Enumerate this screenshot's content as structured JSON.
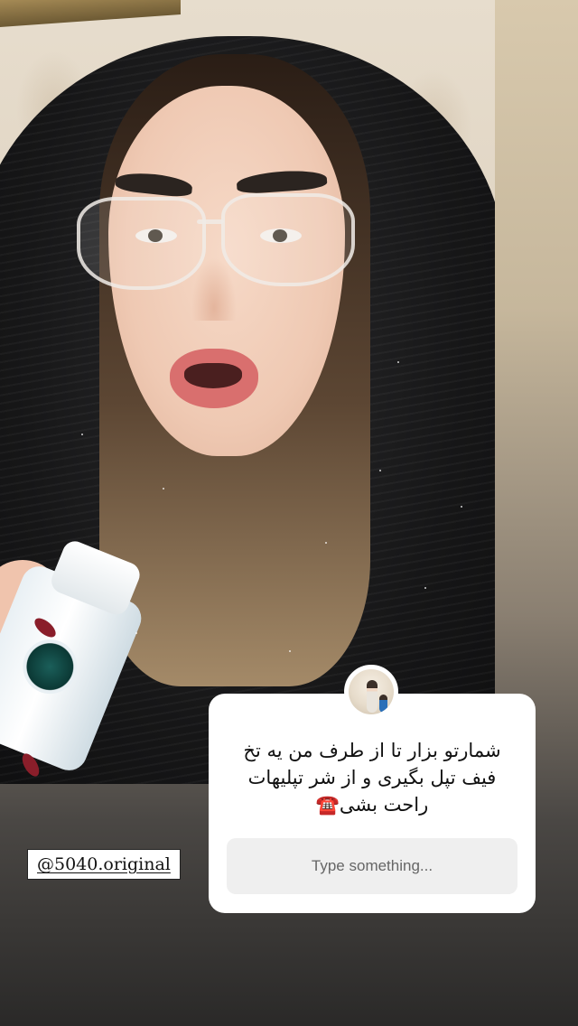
{
  "story": {
    "mention_tag": "@5040.original",
    "question": {
      "text": "شمارتو بزار تا از طرف من یه تخ\nفیف تپل بگیری و از شر تپلیهات\nراحت بشی☎️",
      "answer_placeholder": "Type something..."
    }
  },
  "colors": {
    "sticker_bg": "#ffffff",
    "input_bg": "#efefef",
    "nail_polish": "#8a1e2a"
  }
}
